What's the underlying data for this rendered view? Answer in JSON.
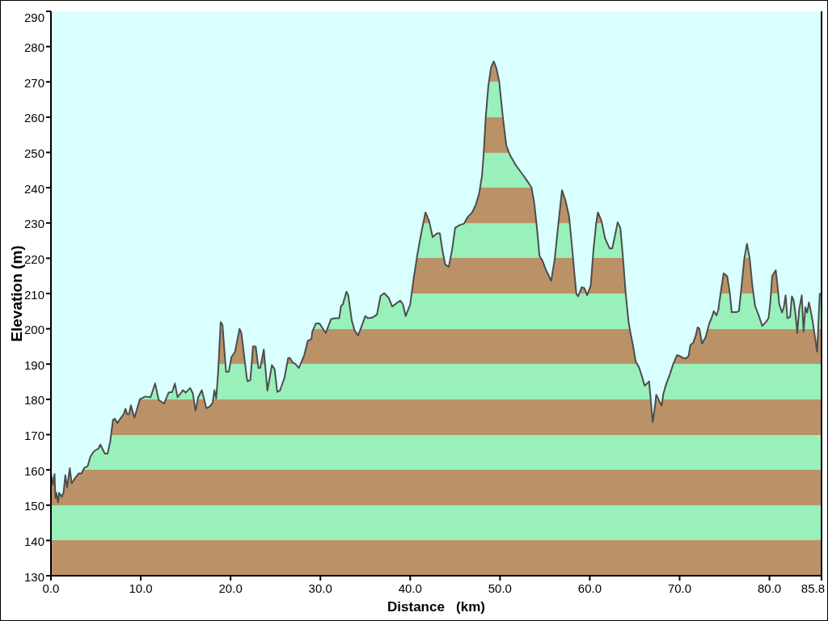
{
  "chart_data": {
    "type": "area",
    "xlabel": "Distance   (km)",
    "ylabel": "Elevation (m)",
    "x": [
      0.0,
      0.2,
      0.4,
      0.5,
      0.6,
      0.8,
      0.9,
      1.2,
      1.4,
      1.6,
      1.8,
      2.1,
      2.3,
      2.7,
      3.1,
      3.4,
      3.7,
      4.1,
      4.4,
      4.8,
      5.3,
      5.5,
      6.0,
      6.3,
      6.6,
      6.9,
      7.1,
      7.4,
      7.8,
      8.1,
      8.3,
      8.5,
      8.7,
      8.9,
      9.3,
      9.9,
      10.5,
      11.1,
      11.6,
      12.0,
      12.6,
      13.1,
      13.5,
      13.8,
      14.1,
      14.7,
      15.0,
      15.5,
      15.8,
      16.1,
      16.4,
      16.8,
      17.3,
      17.7,
      18.0,
      18.2,
      18.4,
      18.6,
      18.9,
      19.1,
      19.5,
      19.8,
      20.1,
      20.5,
      21.0,
      21.2,
      21.8,
      21.9,
      22.2,
      22.5,
      22.8,
      23.1,
      23.3,
      23.7,
      24.1,
      24.6,
      24.9,
      25.2,
      25.5,
      26.0,
      26.4,
      26.6,
      26.9,
      27.2,
      27.6,
      28.2,
      28.6,
      29.0,
      29.1,
      29.5,
      29.9,
      30.6,
      31.2,
      31.7,
      32.1,
      32.3,
      32.5,
      32.9,
      33.1,
      33.5,
      33.8,
      34.2,
      34.6,
      35.0,
      35.3,
      35.8,
      36.3,
      36.7,
      37.1,
      37.6,
      38.0,
      38.5,
      38.9,
      39.2,
      39.5,
      40.0,
      40.4,
      40.8,
      41.2,
      41.7,
      42.1,
      42.5,
      43.0,
      43.3,
      43.6,
      43.9,
      44.3,
      44.7,
      45.0,
      45.5,
      46.0,
      46.4,
      46.9,
      47.3,
      47.7,
      48.0,
      48.2,
      48.4,
      48.7,
      49.0,
      49.3,
      49.6,
      49.9,
      50.3,
      50.7,
      51.1,
      51.7,
      52.3,
      52.9,
      53.5,
      53.8,
      54.1,
      54.4,
      54.7,
      55.1,
      55.7,
      56.1,
      56.5,
      56.9,
      57.3,
      57.7,
      58.0,
      58.3,
      58.5,
      58.7,
      59.1,
      59.4,
      59.7,
      60.1,
      60.4,
      60.7,
      60.9,
      61.3,
      61.7,
      62.2,
      62.5,
      62.8,
      63.1,
      63.4,
      63.7,
      64.0,
      64.3,
      64.5,
      64.8,
      65.1,
      65.5,
      65.8,
      66.1,
      66.3,
      66.6,
      66.8,
      67.0,
      67.2,
      67.4,
      67.7,
      68.0,
      68.2,
      68.5,
      68.9,
      69.3,
      69.7,
      70.0,
      70.4,
      70.7,
      71.0,
      71.2,
      71.5,
      71.8,
      72.0,
      72.2,
      72.5,
      72.9,
      73.3,
      73.6,
      73.8,
      74.1,
      74.3,
      74.6,
      74.9,
      75.3,
      75.6,
      75.8,
      76.3,
      76.6,
      76.9,
      77.2,
      77.5,
      77.8,
      78.1,
      78.4,
      78.8,
      79.2,
      79.6,
      79.9,
      80.1,
      80.3,
      80.7,
      80.9,
      81.1,
      81.4,
      81.6,
      81.8,
      82.0,
      82.3,
      82.5,
      82.7,
      82.9,
      83.1,
      83.3,
      83.6,
      83.8,
      84.0,
      84.2,
      84.4,
      84.6,
      84.8,
      85.0,
      85.3,
      85.4,
      85.6,
      85.8
    ],
    "values": [
      159.0,
      155.8,
      158.8,
      152.0,
      153.5,
      150.8,
      153.5,
      152.4,
      153.5,
      158.5,
      155.0,
      160.5,
      156.2,
      157.7,
      159.0,
      159.0,
      160.5,
      161.1,
      163.8,
      165.3,
      166.1,
      167.2,
      164.6,
      164.6,
      168.0,
      174.1,
      174.5,
      173.3,
      174.8,
      175.8,
      177.3,
      175.8,
      175.8,
      178.3,
      174.8,
      180.0,
      180.8,
      180.6,
      184.5,
      179.8,
      178.8,
      181.9,
      182.1,
      184.5,
      180.6,
      182.6,
      181.9,
      183.2,
      181.7,
      176.8,
      180.6,
      182.6,
      177.5,
      178.0,
      179.0,
      182.6,
      180.2,
      187.0,
      201.9,
      201.1,
      187.8,
      187.8,
      192.0,
      193.5,
      200.0,
      198.9,
      186.3,
      185.1,
      185.5,
      195.0,
      195.0,
      188.9,
      188.9,
      194.1,
      182.5,
      189.7,
      188.6,
      182.1,
      182.5,
      186.1,
      191.6,
      191.8,
      190.5,
      190.1,
      188.9,
      192.5,
      196.6,
      197.1,
      199.2,
      201.5,
      201.5,
      198.8,
      202.8,
      203.0,
      203.0,
      206.5,
      206.9,
      210.5,
      209.5,
      202.3,
      199.6,
      198.1,
      200.8,
      203.6,
      203.0,
      203.2,
      204.0,
      209.3,
      210.1,
      208.8,
      206.3,
      207.3,
      208.0,
      206.9,
      203.6,
      206.9,
      214.5,
      221.0,
      226.7,
      233.0,
      230.6,
      226.0,
      227.1,
      227.1,
      222.1,
      218.2,
      217.6,
      222.9,
      228.6,
      229.4,
      229.8,
      231.7,
      233.0,
      235.1,
      238.6,
      243.5,
      250.4,
      259.6,
      268.8,
      274.1,
      275.8,
      273.8,
      270.3,
      260.4,
      252.0,
      249.3,
      246.6,
      244.5,
      242.4,
      240.1,
      235.9,
      229.0,
      220.6,
      219.5,
      216.8,
      213.6,
      219.9,
      229.8,
      239.3,
      236.3,
      231.7,
      223.7,
      215.3,
      209.9,
      209.2,
      211.8,
      211.5,
      209.5,
      212.2,
      222.2,
      229.8,
      233.0,
      230.6,
      225.6,
      222.8,
      222.8,
      226.4,
      230.2,
      228.6,
      219.9,
      209.9,
      202.3,
      199.2,
      195.4,
      190.8,
      188.9,
      186.6,
      183.9,
      184.3,
      185.1,
      179.4,
      173.6,
      177.1,
      181.3,
      179.7,
      178.2,
      181.7,
      184.3,
      187.0,
      190.1,
      192.5,
      192.3,
      191.7,
      191.6,
      192.3,
      195.4,
      196.0,
      198.1,
      200.4,
      200.0,
      195.8,
      197.7,
      201.5,
      203.4,
      205.0,
      203.8,
      205.3,
      210.7,
      215.7,
      214.9,
      209.9,
      204.7,
      204.7,
      205.0,
      212.2,
      219.9,
      224.1,
      219.9,
      212.2,
      206.5,
      203.8,
      200.8,
      201.9,
      203.0,
      207.6,
      214.9,
      216.6,
      212.2,
      206.9,
      204.6,
      206.1,
      209.5,
      203.0,
      203.4,
      209.2,
      208.0,
      204.2,
      198.8,
      205.3,
      209.5,
      199.2,
      206.1,
      204.6,
      207.5,
      205.0,
      202.3,
      198.8,
      193.5,
      198.5,
      209.9,
      210.1
    ],
    "xlim": [
      0,
      85.8
    ],
    "ylim": [
      130,
      290
    ],
    "xticks": [
      {
        "value": 0,
        "label": "0.0"
      },
      {
        "value": 10,
        "label": "10.0"
      },
      {
        "value": 20,
        "label": "20.0"
      },
      {
        "value": 30,
        "label": "30.0"
      },
      {
        "value": 40,
        "label": "40.0"
      },
      {
        "value": 50,
        "label": "50.0"
      },
      {
        "value": 60,
        "label": "60.0"
      },
      {
        "value": 70,
        "label": "70.0"
      },
      {
        "value": 80,
        "label": "80.0"
      },
      {
        "value": 85.8,
        "label": "85.8"
      }
    ],
    "yticks": [
      130,
      140,
      150,
      160,
      170,
      180,
      190,
      200,
      210,
      220,
      230,
      240,
      250,
      260,
      270,
      280,
      290
    ]
  }
}
